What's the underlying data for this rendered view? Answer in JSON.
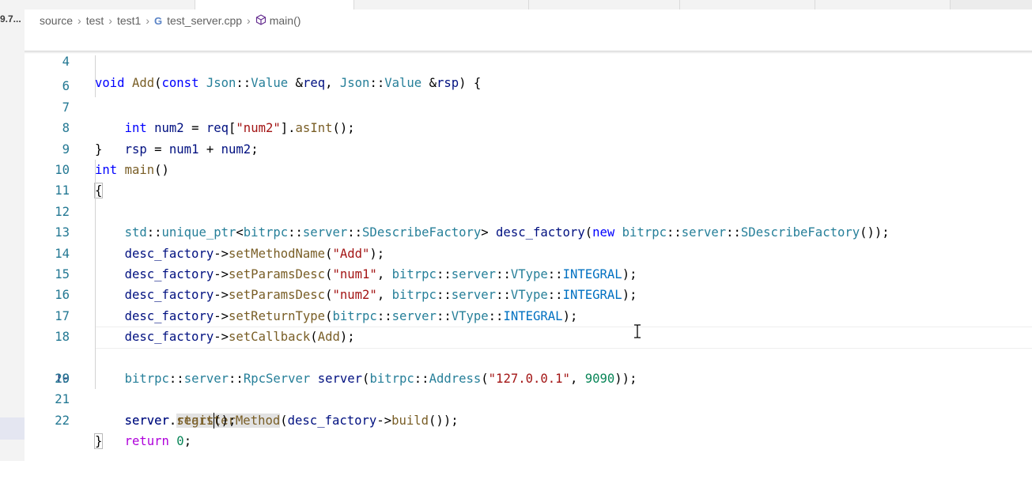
{
  "left_panel": {
    "label": "9.7..."
  },
  "breadcrumb": {
    "items": [
      "source",
      "test",
      "test1",
      "test_server.cpp",
      "main()"
    ]
  },
  "editor": {
    "current_line": "19",
    "lines": [
      {
        "num": "4",
        "text": "void Add(const Json::Value &req, Json::Value &rsp) {"
      },
      {
        "num": "6",
        "text": "    int num2 = req[\"num2\"].asInt();"
      },
      {
        "num": "7",
        "text": "    rsp = num1 + num2;"
      },
      {
        "num": "8",
        "text": "}"
      },
      {
        "num": "9",
        "text": "int main()"
      },
      {
        "num": "10",
        "text": "{"
      },
      {
        "num": "11",
        "text": "    std::unique_ptr<bitrpc::server::SDescribeFactory> desc_factory(new bitrpc::server::SDescribeFactory());"
      },
      {
        "num": "12",
        "text": "    desc_factory->setMethodName(\"Add\");"
      },
      {
        "num": "13",
        "text": "    desc_factory->setParamsDesc(\"num1\", bitrpc::server::VType::INTEGRAL);"
      },
      {
        "num": "14",
        "text": "    desc_factory->setParamsDesc(\"num2\", bitrpc::server::VType::INTEGRAL);"
      },
      {
        "num": "15",
        "text": "    desc_factory->setReturnType(bitrpc::server::VType::INTEGRAL);"
      },
      {
        "num": "16",
        "text": "    desc_factory->setCallback(Add);"
      },
      {
        "num": "17",
        "text": ""
      },
      {
        "num": "18",
        "text": "    bitrpc::server::RpcServer server(bitrpc::Address(\"127.0.0.1\", 9090));"
      },
      {
        "num": "19",
        "text": "    server.registerMethod(desc_factory->build());"
      },
      {
        "num": "20",
        "text": "    server.start();"
      },
      {
        "num": "21",
        "text": "    return 0;"
      },
      {
        "num": "22",
        "text": "}"
      }
    ]
  },
  "icons": {
    "breadcrumb_file": "cpp-file-icon",
    "breadcrumb_symbol": "symbol-method-cube-icon",
    "mouse_cursor": "text-ibeam-cursor-icon"
  },
  "colors": {
    "keyword": "#0000ff",
    "control_keyword": "#af00db",
    "type": "#267f99",
    "function": "#795e26",
    "string": "#a31515",
    "number": "#098658",
    "line_number": "#237893"
  }
}
